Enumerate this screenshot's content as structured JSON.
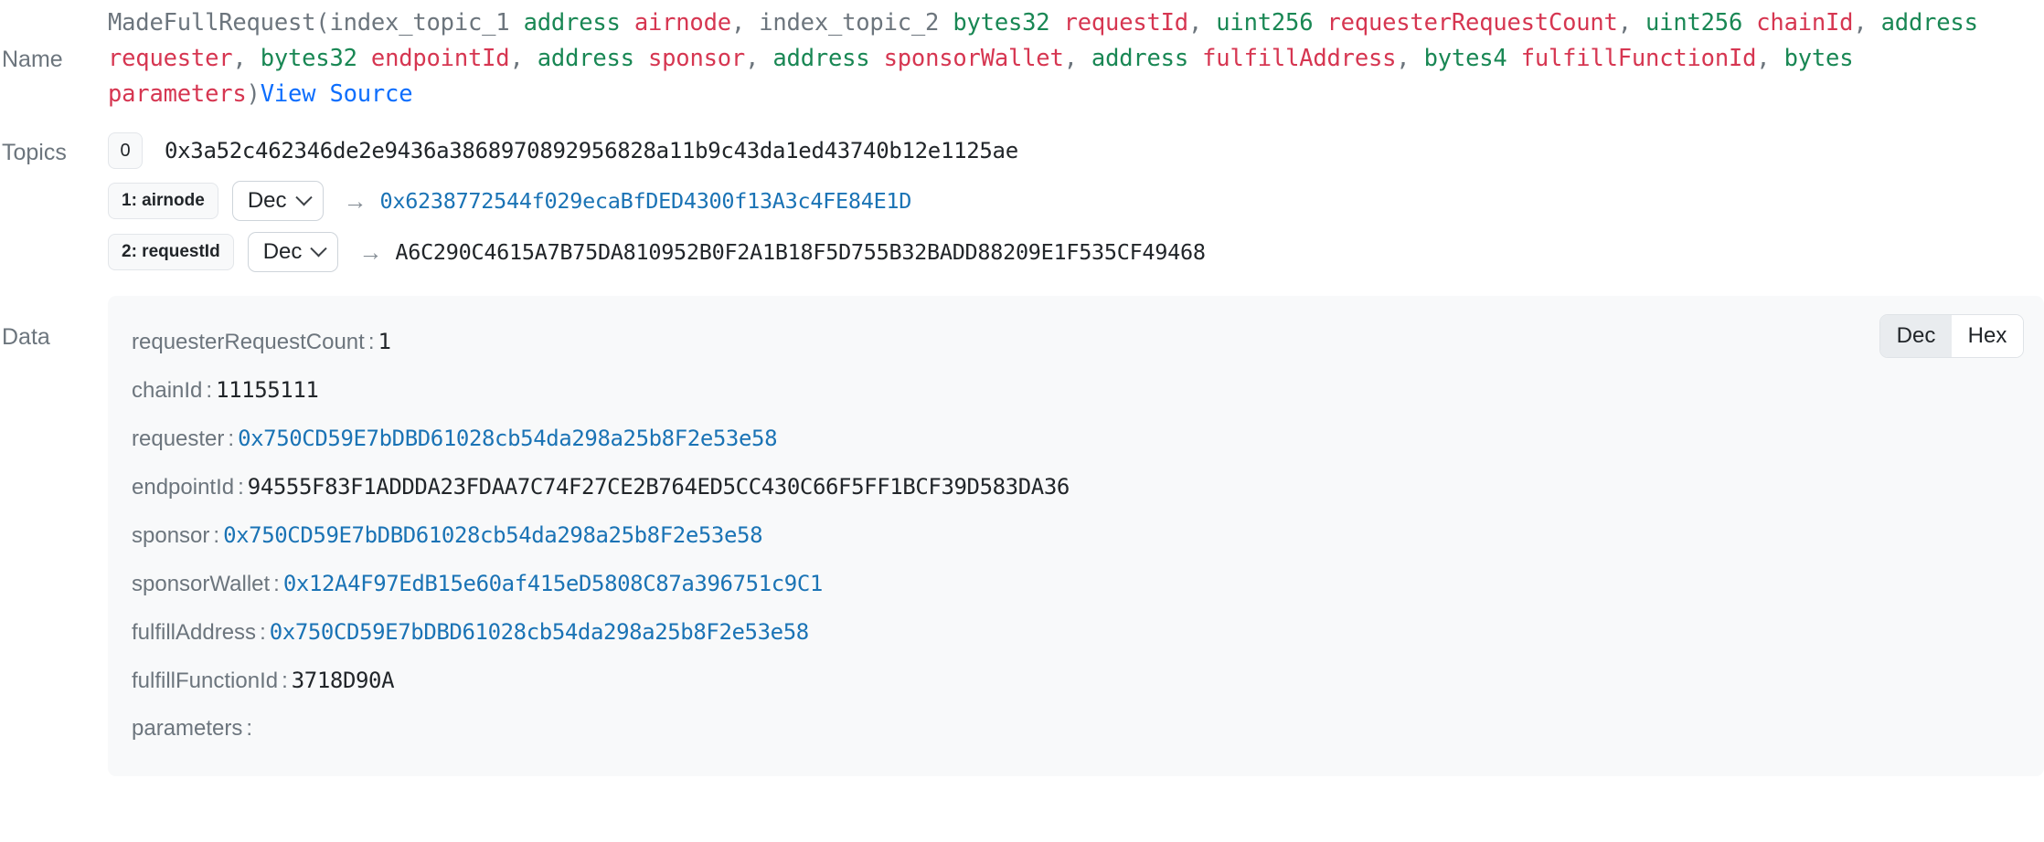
{
  "labels": {
    "name": "Name",
    "topics": "Topics",
    "data": "Data"
  },
  "event_signature": {
    "event_name": "MadeFullRequest",
    "open_paren": "(",
    "close_paren": ")",
    "view_source": "View Source",
    "tokens": [
      {
        "text": "index_topic_1",
        "kind": "plain"
      },
      {
        "text": "address",
        "kind": "type"
      },
      {
        "text": "airnode",
        "kind": "param"
      },
      {
        "text": ",",
        "kind": "punct"
      },
      {
        "text": "index_topic_2",
        "kind": "plain"
      },
      {
        "text": "bytes32",
        "kind": "type"
      },
      {
        "text": "requestId",
        "kind": "param"
      },
      {
        "text": ",",
        "kind": "punct"
      },
      {
        "text": "uint256",
        "kind": "type"
      },
      {
        "text": "requesterRequestCount",
        "kind": "param"
      },
      {
        "text": ",",
        "kind": "punct"
      },
      {
        "text": "uint256",
        "kind": "type"
      },
      {
        "text": "chainId",
        "kind": "param"
      },
      {
        "text": ",",
        "kind": "punct"
      },
      {
        "text": "address",
        "kind": "type"
      },
      {
        "text": "requester",
        "kind": "param"
      },
      {
        "text": ",",
        "kind": "punct"
      },
      {
        "text": "bytes32",
        "kind": "type"
      },
      {
        "text": "endpointId",
        "kind": "param"
      },
      {
        "text": ",",
        "kind": "punct"
      },
      {
        "text": "address",
        "kind": "type"
      },
      {
        "text": "sponsor",
        "kind": "param"
      },
      {
        "text": ",",
        "kind": "punct"
      },
      {
        "text": "address",
        "kind": "type"
      },
      {
        "text": "sponsorWallet",
        "kind": "param"
      },
      {
        "text": ",",
        "kind": "punct"
      },
      {
        "text": "address",
        "kind": "type"
      },
      {
        "text": "fulfillAddress",
        "kind": "param"
      },
      {
        "text": ",",
        "kind": "punct"
      },
      {
        "text": "bytes4",
        "kind": "type"
      },
      {
        "text": "fulfillFunctionId",
        "kind": "param"
      },
      {
        "text": ",",
        "kind": "punct"
      },
      {
        "text": "bytes",
        "kind": "type"
      },
      {
        "text": "parameters",
        "kind": "param"
      }
    ]
  },
  "topics": [
    {
      "index_label": "0",
      "value": "0x3a52c462346de2e9436a3868970892956828a11b9c43da1ed43740b12e1125ae",
      "has_format_select": false,
      "is_link": false
    },
    {
      "index_label": "1: airnode",
      "format": "Dec",
      "arrow": "→",
      "value": "0x6238772544f029ecaBfDED4300f13A3c4FE84E1D",
      "has_format_select": true,
      "is_link": true
    },
    {
      "index_label": "2: requestId",
      "format": "Dec",
      "arrow": "→",
      "value": "A6C290C4615A7B75DA810952B0F2A1B18F5D755B32BADD88209E1F535CF49468",
      "has_format_select": true,
      "is_link": false
    }
  ],
  "format_options": [
    "Dec",
    "Hex"
  ],
  "data_panel": {
    "toggle": {
      "options": [
        "Dec",
        "Hex"
      ],
      "selected": "Dec"
    },
    "items": [
      {
        "key": "requesterRequestCount",
        "separator": ":",
        "value": "1",
        "is_link": false
      },
      {
        "key": "chainId",
        "separator": ":",
        "value": "11155111",
        "is_link": false
      },
      {
        "key": "requester",
        "separator": ":",
        "value": "0x750CD59E7bDBD61028cb54da298a25b8F2e53e58",
        "is_link": true
      },
      {
        "key": "endpointId",
        "separator": ":",
        "value": "94555F83F1ADDDA23FDAA7C74F27CE2B764ED5CC430C66F5FF1BCF39D583DA36",
        "is_link": false
      },
      {
        "key": "sponsor",
        "separator": ":",
        "value": "0x750CD59E7bDBD61028cb54da298a25b8F2e53e58",
        "is_link": true
      },
      {
        "key": "sponsorWallet",
        "separator": ":",
        "value": "0x12A4F97EdB15e60af415eD5808C87a396751c9C1",
        "is_link": true
      },
      {
        "key": "fulfillAddress",
        "separator": ":",
        "value": "0x750CD59E7bDBD61028cb54da298a25b8F2e53e58",
        "is_link": true
      },
      {
        "key": "fulfillFunctionId",
        "separator": ":",
        "value": "3718D90A",
        "is_link": false
      },
      {
        "key": "parameters",
        "separator": ":",
        "value": "",
        "is_link": false
      }
    ]
  },
  "colors": {
    "type_green": "#198754",
    "param_red": "#d63651",
    "link_blue": "#1a73b5",
    "source_blue": "#0d6efd",
    "muted": "#6c757d",
    "panel_bg": "#f8f9fa"
  }
}
